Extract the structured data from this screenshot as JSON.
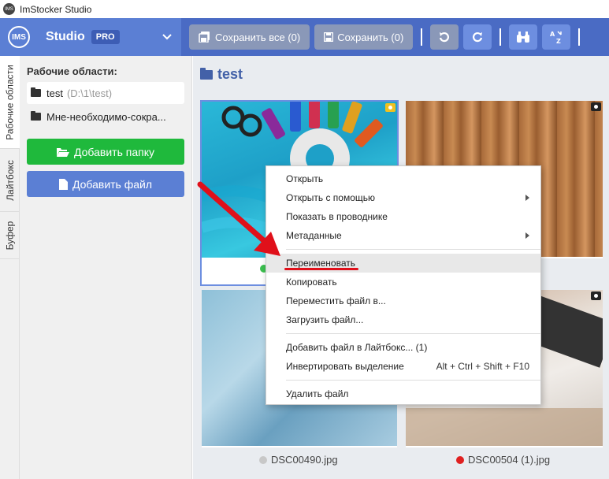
{
  "window": {
    "title": "ImStocker Studio",
    "icon_text": "IMS"
  },
  "brand": {
    "logo": "IMS",
    "name": "Studio",
    "badge": "PRO"
  },
  "toolbar": {
    "save_all": "Сохранить все (0)",
    "save": "Сохранить (0)"
  },
  "vtabs": [
    "Рабочие области",
    "Лайтбокс",
    "Буфер"
  ],
  "sidebar": {
    "title": "Рабочие области:",
    "items": [
      {
        "name": "test",
        "path": "(D:\\1\\test)"
      },
      {
        "name": "Мне-необходимо-сокра..."
      }
    ],
    "add_folder": "Добавить папку",
    "add_file": "Добавить файл"
  },
  "main": {
    "title": "test",
    "files": [
      {
        "name": "DSC00490.jpg",
        "status_color": "#c8c8c8"
      },
      {
        "name": "DSC00504 (1).jpg",
        "status_color": "#e02020"
      }
    ]
  },
  "context_menu": {
    "items": [
      {
        "label": "Открыть"
      },
      {
        "label": "Открыть с помощью"
      },
      {
        "label": "Показать в проводнике"
      },
      {
        "label": "Метаданные"
      },
      {
        "label": "Переименовать"
      },
      {
        "label": "Копировать"
      },
      {
        "label": "Переместить файл в..."
      },
      {
        "label": "Загрузить файл..."
      },
      {
        "label": "Добавить файл в Лайтбокс... (1)"
      },
      {
        "label": "Инвертировать выделение",
        "shortcut": "Alt + Ctrl + Shift + F10"
      },
      {
        "label": "Удалить файл"
      }
    ]
  },
  "colors": {
    "brand": "#5b7fd4",
    "toolbar": "#4a6bc4",
    "add_folder": "#1fb93c",
    "annotation": "#e0101a"
  }
}
